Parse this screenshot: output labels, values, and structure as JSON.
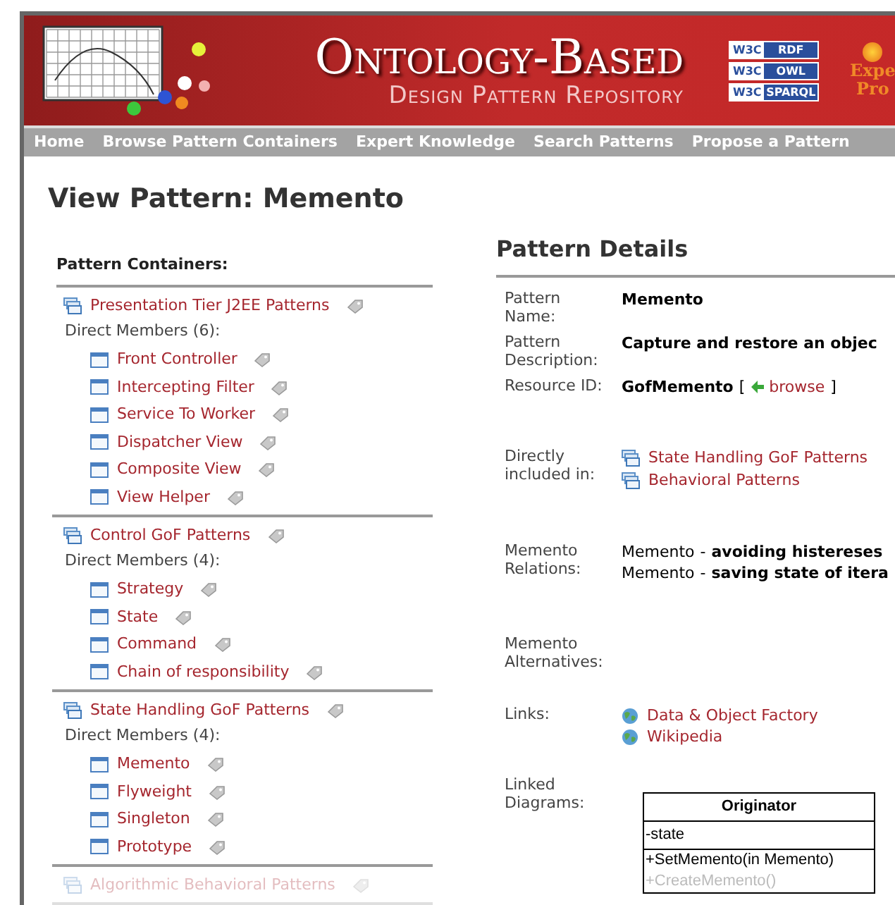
{
  "header": {
    "title": "Ontology-Based",
    "subtitle": "Design Pattern Repository",
    "badges": [
      {
        "logo": "W3C",
        "label": "RDF"
      },
      {
        "logo": "W3C",
        "label": "OWL"
      },
      {
        "logo": "W3C",
        "label": "SPARQL"
      }
    ],
    "promo": [
      "Expe",
      "Pro"
    ]
  },
  "nav": [
    "Home",
    "Browse Pattern Containers",
    "Expert Knowledge",
    "Search Patterns",
    "Propose a Pattern"
  ],
  "page_title": "View Pattern: Memento",
  "containers_heading": "Pattern Containers:",
  "containers": [
    {
      "name": "Presentation Tier J2EE Patterns",
      "faded": false,
      "members_label": "Direct Members (6):",
      "members": [
        "Front Controller",
        "Intercepting Filter",
        "Service To Worker",
        "Dispatcher View",
        "Composite View",
        "View Helper"
      ]
    },
    {
      "name": "Control GoF Patterns",
      "faded": false,
      "members_label": "Direct Members (4):",
      "members": [
        "Strategy",
        "State",
        "Command",
        "Chain of responsibility"
      ]
    },
    {
      "name": "State Handling GoF Patterns",
      "faded": false,
      "members_label": "Direct Members (4):",
      "members": [
        "Memento",
        "Flyweight",
        "Singleton",
        "Prototype"
      ]
    },
    {
      "name": "Algorithmic Behavioral Patterns",
      "faded": true
    }
  ],
  "details_heading": "Pattern Details",
  "details": [
    {
      "kind": "bold",
      "label": "Pattern Name:",
      "value": "Memento"
    },
    {
      "kind": "bold",
      "label": "Pattern Description:",
      "value": "Capture and restore an objec"
    },
    {
      "kind": "resource",
      "label": "Resource ID:",
      "value": "GofMemento",
      "open": "[",
      "link": "browse",
      "close": "]"
    },
    {
      "kind": "containers",
      "label": "Directly included in:",
      "items": [
        "State Handling GoF Patterns",
        "Behavioral Patterns"
      ]
    },
    {
      "kind": "relations",
      "label": "Memento Relations:",
      "items": [
        {
          "name": "Memento",
          "sep": "-",
          "text": "avoiding histereses"
        },
        {
          "name": "Memento",
          "sep": "-",
          "text": "saving state of itera"
        }
      ]
    },
    {
      "kind": "empty",
      "label": "Memento Alternatives:"
    },
    {
      "kind": "links",
      "label": "Links:",
      "items": [
        "Data & Object Factory",
        "Wikipedia"
      ]
    },
    {
      "kind": "diagram",
      "label": "Linked Diagrams:",
      "class_name": "Originator",
      "attributes": [
        "-state"
      ],
      "methods": [
        {
          "text": "+SetMemento(in Memento)",
          "faded": false
        },
        {
          "text": "+CreateMemento()",
          "faded": true
        }
      ]
    }
  ]
}
